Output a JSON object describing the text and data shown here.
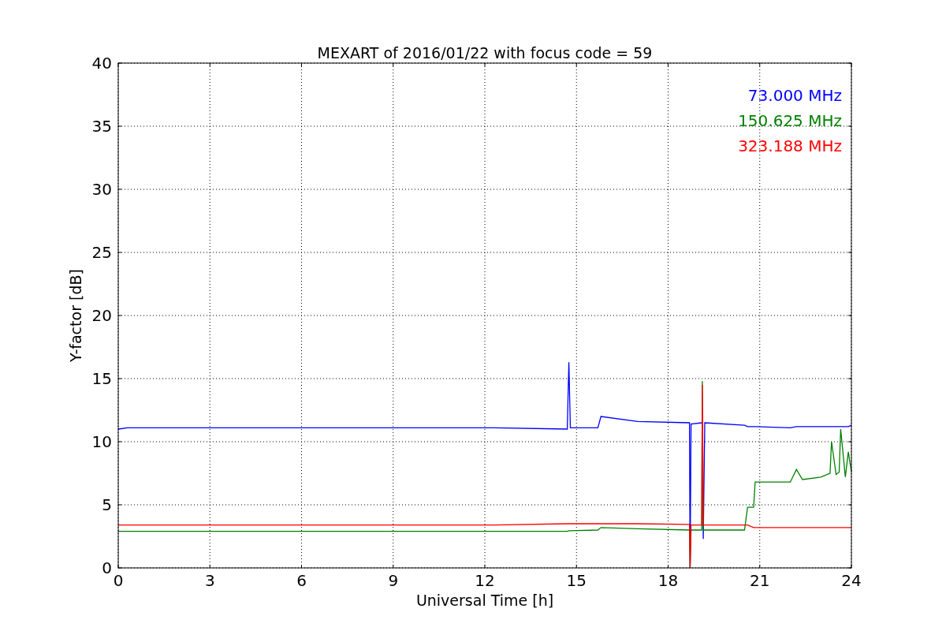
{
  "chart_data": {
    "type": "line",
    "grid": true,
    "title": "MEXART of 2016/01/22 with focus code = 59",
    "xlabel": "Universal Time [h]",
    "ylabel": "Y-factor [dB]",
    "x": [
      0,
      0.3,
      12.3,
      14.7,
      14.75,
      14.8,
      15.7,
      15.8,
      17,
      18.7,
      18.72,
      18.75,
      19.1,
      19.12,
      19.15,
      19.2,
      20.5,
      20.6,
      20.8,
      20.85,
      22,
      22.2,
      22.4,
      23,
      23.3,
      23.35,
      23.5,
      23.6,
      23.65,
      23.8,
      23.9,
      24
    ],
    "series": [
      {
        "name": "73.000 MHz",
        "color": "#0000ff",
        "values": [
          11.0,
          11.1,
          11.1,
          11.0,
          16.3,
          11.1,
          11.1,
          12.0,
          11.6,
          11.5,
          0,
          11.4,
          11.5,
          11.4,
          2.3,
          11.5,
          11.3,
          11.2,
          11.2,
          11.2,
          11.1,
          11.2,
          11.2,
          11.2,
          11.2,
          11.2,
          11.2,
          11.2,
          11.2,
          11.2,
          11.2,
          11.3
        ]
      },
      {
        "name": "150.625 MHz",
        "color": "#008000",
        "values": [
          2.9,
          2.9,
          2.9,
          2.9,
          2.95,
          2.95,
          3.0,
          3.2,
          3.1,
          3.0,
          0,
          3.0,
          3.0,
          14.8,
          3.0,
          3.0,
          3.0,
          4.8,
          4.8,
          6.8,
          6.8,
          7.8,
          7.0,
          7.2,
          7.5,
          10.0,
          7.4,
          7.6,
          11.0,
          7.2,
          9.2,
          7.6
        ]
      },
      {
        "name": "323.188 MHz",
        "color": "#ff0000",
        "values": [
          3.4,
          3.4,
          3.4,
          3.5,
          3.5,
          3.5,
          3.5,
          3.5,
          3.5,
          3.45,
          0,
          3.4,
          3.4,
          14.5,
          3.4,
          3.4,
          3.4,
          3.4,
          3.2,
          3.2,
          3.2,
          3.2,
          3.2,
          3.2,
          3.2,
          3.2,
          3.2,
          3.2,
          3.2,
          3.2,
          3.2,
          3.2
        ]
      }
    ],
    "xlim": [
      0,
      24
    ],
    "ylim": [
      0,
      40
    ],
    "xticks": [
      0,
      3,
      6,
      9,
      12,
      15,
      18,
      21,
      24
    ],
    "yticks": [
      0,
      5,
      10,
      15,
      20,
      25,
      30,
      35,
      40
    ]
  }
}
